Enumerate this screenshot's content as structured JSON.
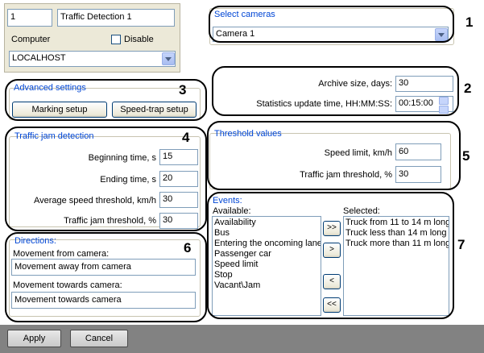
{
  "top": {
    "id_value": "1",
    "name_value": "Traffic Detection 1",
    "computer_label": "Computer",
    "disable_label": "Disable",
    "computer_value": "LOCALHOST"
  },
  "cameras": {
    "group_title": "Select cameras",
    "selected": "Camera 1"
  },
  "advanced": {
    "group_title": "Advanced settings",
    "marking_button": "Marking setup",
    "speedtrap_button": "Speed-trap setup"
  },
  "archive": {
    "archive_label": "Archive size, days:",
    "archive_value": "30",
    "stats_label": "Statistics update time, HH:MM:SS:",
    "stats_value": "00:15:00"
  },
  "jam": {
    "group_title": "Traffic jam detection",
    "begin_label": "Beginning time, s",
    "begin_value": "15",
    "end_label": "Ending time, s",
    "end_value": "20",
    "avg_label": "Average speed threshold, km/h",
    "avg_value": "30",
    "thr_label": "Traffic jam threshold, %",
    "thr_value": "30"
  },
  "threshold": {
    "group_title": "Threshold values",
    "speed_label": "Speed limit, km/h",
    "speed_value": "60",
    "jam_label": "Traffic jam threshold, %",
    "jam_value": "30"
  },
  "directions": {
    "group_title": "Directions:",
    "from_label": "Movement from camera:",
    "from_value": "Movement away from camera",
    "towards_label": "Movement towards camera:",
    "towards_value": "Movement towards camera"
  },
  "events": {
    "group_title": "Events:",
    "available_label": "Available:",
    "selected_label": "Selected:",
    "available": [
      "Availability",
      "Bus",
      "Entering the oncoming lane",
      "Passenger car",
      "Speed limit",
      "Stop",
      "Vacant\\Jam"
    ],
    "selected": [
      "Truck from 11 to 14 m long",
      "Truck less than 14 m long",
      "Truck more than 11 m long"
    ],
    "add_all": ">>",
    "add": ">",
    "remove": "<",
    "remove_all": "<<"
  },
  "callouts": [
    "1",
    "2",
    "3",
    "4",
    "5",
    "6",
    "7"
  ],
  "footer": {
    "apply": "Apply",
    "cancel": "Cancel"
  },
  "colors": {
    "panel_bg": "#ece9d8",
    "group_title": "#0046d5",
    "bottom_bar": "#828282",
    "callout_border": "#000000"
  }
}
